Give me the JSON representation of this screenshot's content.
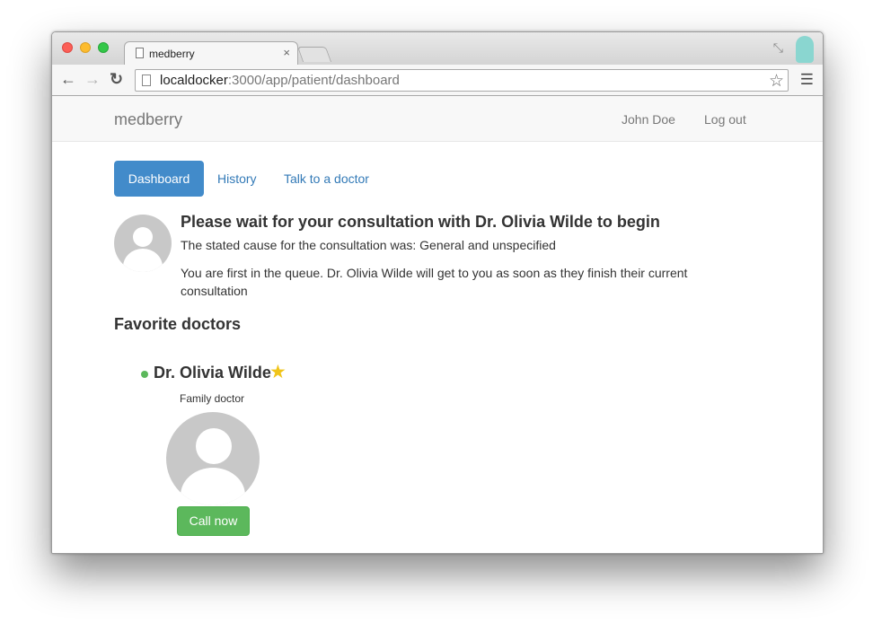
{
  "browser": {
    "tab_title": "medberry",
    "tab_close": "×",
    "url_host": "localdocker",
    "url_rest": ":3000/app/patient/dashboard",
    "icons": {
      "back": "back-arrow-icon",
      "forward": "forward-arrow-icon",
      "reload": "reload-icon",
      "bookmark": "star-outline-icon",
      "menu": "hamburger-menu-icon",
      "fullscreen": "restore-arrows-icon",
      "profile": "profile-avatar-icon"
    }
  },
  "navbar": {
    "brand": "medberry",
    "user": "John Doe",
    "logout": "Log out"
  },
  "tabs": [
    {
      "label": "Dashboard",
      "active": true
    },
    {
      "label": "History",
      "active": false
    },
    {
      "label": "Talk to a doctor",
      "active": false
    }
  ],
  "consultation": {
    "heading": "Please wait for your consultation with Dr. Olivia Wilde to begin",
    "cause": "The stated cause for the consultation was: General and unspecified",
    "queue_text": "You are first in the queue. Dr. Olivia Wilde will get to you as soon as they finish their current consultation"
  },
  "favorites": {
    "title": "Favorite doctors",
    "doctors": [
      {
        "name": "Dr. Olivia Wilde",
        "role": "Family doctor",
        "status": "online",
        "favorite": true,
        "call_label": "Call now"
      }
    ]
  },
  "colors": {
    "primary": "#428bca",
    "link": "#337ab7",
    "success": "#5cb85c",
    "star": "#f0c419"
  }
}
